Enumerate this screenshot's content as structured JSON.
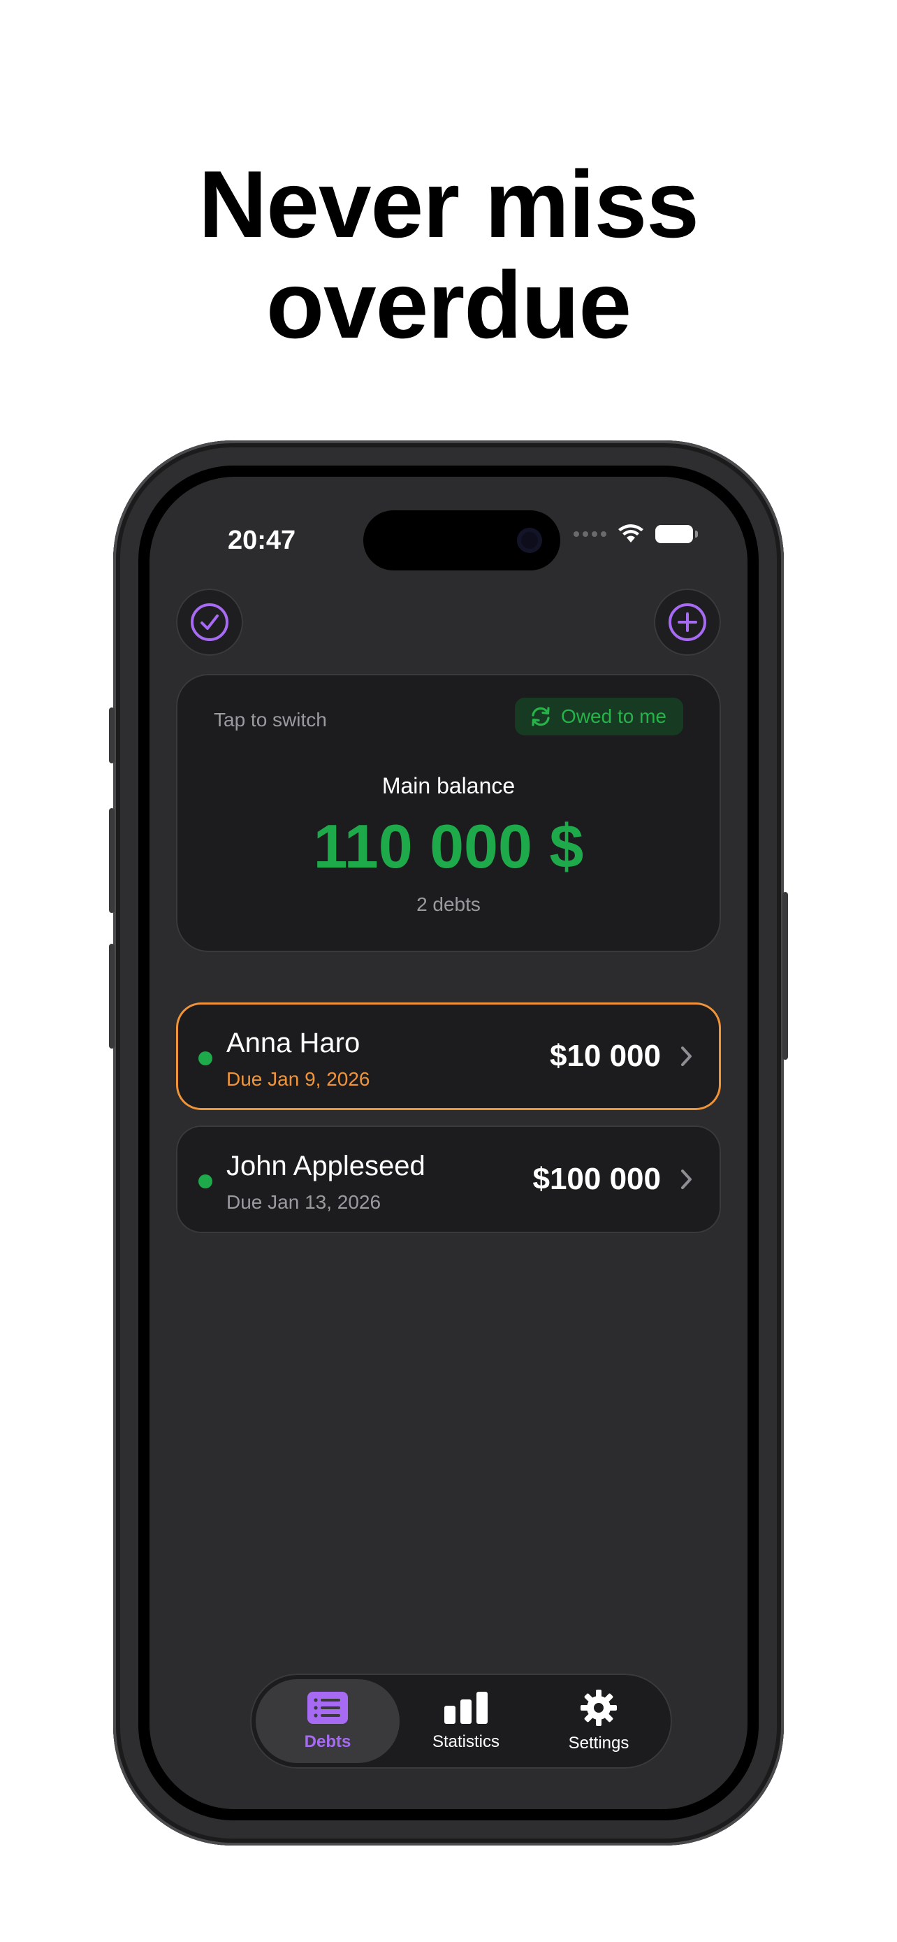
{
  "headline": {
    "line1": "Never miss",
    "line2": "overdue"
  },
  "status_bar": {
    "time": "20:47"
  },
  "balance": {
    "hint": "Tap to switch",
    "mode_label": "Owed to me",
    "title": "Main balance",
    "amount": "110 000 $",
    "count": "2 debts"
  },
  "debts": [
    {
      "name": "Anna Haro",
      "due": "Due Jan 9, 2026",
      "amount": "$10 000",
      "overdue": true
    },
    {
      "name": "John Appleseed",
      "due": "Due Jan 13, 2026",
      "amount": "$100 000",
      "overdue": false
    }
  ],
  "tabs": [
    {
      "label": "Debts",
      "icon": "list-icon",
      "active": true
    },
    {
      "label": "Statistics",
      "icon": "bar-chart-icon",
      "active": false
    },
    {
      "label": "Settings",
      "icon": "gear-icon",
      "active": false
    }
  ],
  "colors": {
    "accent": "#a66bf2",
    "positive": "#1ea94a",
    "overdue": "#f0943a",
    "card": "#1c1c1e",
    "background": "#2c2c2e"
  }
}
